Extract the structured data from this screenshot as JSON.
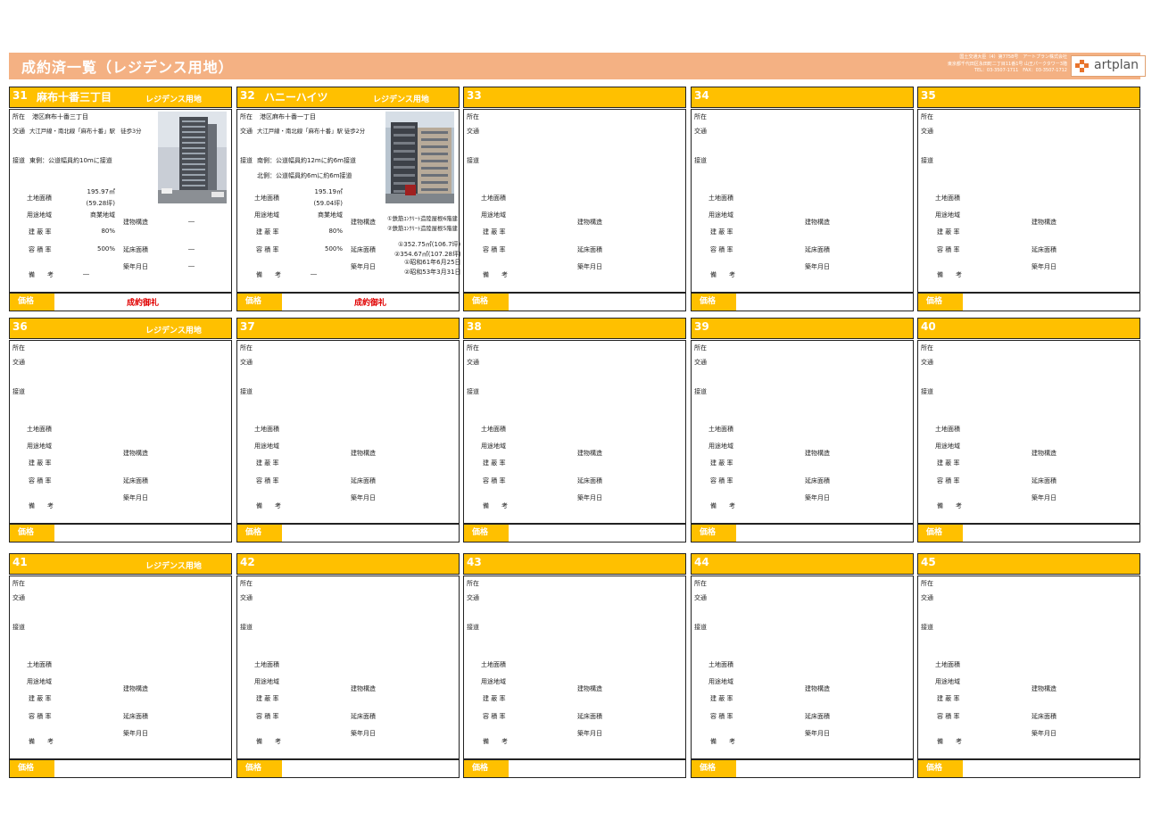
{
  "page": {
    "title": "成約済一覧（レジデンス用地）",
    "company": {
      "line1": "国土交通大臣（4）第7758号　アートプラン株式会社",
      "line2": "東京都千代田区永田町二丁目11番1号 山王パークタワー3階",
      "line3": "TEL：03-3507-1711　FAX：03-3507-1712"
    },
    "logo_text": "artplan",
    "colors": {
      "banner": "#f4b183",
      "header": "#ffc000",
      "sold": "#e00000"
    }
  },
  "labels": {
    "location": "所在",
    "access": "交通",
    "road": "接道",
    "land_area": "土地面積",
    "zoning": "用途地域",
    "coverage": "建 蔽 率",
    "far": "容 積 率",
    "remarks": "備　　考",
    "structure": "建物構造",
    "floor_area": "延床面積",
    "built": "築年月日",
    "price": "価格"
  },
  "cards": [
    {
      "num": "31",
      "name": "麻布十番三丁目",
      "tag": "レジデンス用地",
      "location": "港区麻布十番三丁目",
      "access": "大江戸線・南北線「麻布十番」駅　徒歩3分",
      "road1": "東側：公道幅員約10mに接道",
      "road2": "",
      "land1": "195.97㎡",
      "land2": "(59.28坪)",
      "zoning": "商業地域",
      "coverage": "80%",
      "far": "500%",
      "remarks": "―",
      "structure1": "―",
      "structure2": "",
      "floor1": "―",
      "floor2": "",
      "built1": "―",
      "built2": "",
      "price": "成約御礼"
    },
    {
      "num": "32",
      "name": "ハニーハイツ",
      "tag": "レジデンス用地",
      "location": "港区麻布十番一丁目",
      "access": "大江戸線・南北線「麻布十番」駅 徒歩2分",
      "road1": "南側：公道幅員約12mに約6m接道",
      "road2": "北側：公道幅員約6mに約6m接道",
      "land1": "195.19㎡",
      "land2": "(59.04坪)",
      "zoning": "商業地域",
      "coverage": "80%",
      "far": "500%",
      "remarks": "―",
      "structure1": "①鉄筋ｺﾝｸﾘｰﾄ造陸屋根6階建",
      "structure2": "②鉄筋ｺﾝｸﾘｰﾄ造陸屋根5階建",
      "floor1": "①352.75㎡(106.7坪)",
      "floor2": "②354.67㎡(107.28坪)",
      "built1": "①昭和61年6月25日",
      "built2": "②昭和53年3月31日",
      "price": "成約御礼"
    },
    {
      "num": "33",
      "name": "",
      "tag": ""
    },
    {
      "num": "34",
      "name": "",
      "tag": ""
    },
    {
      "num": "35",
      "name": "",
      "tag": ""
    },
    {
      "num": "36",
      "name": "",
      "tag": "レジデンス用地"
    },
    {
      "num": "37",
      "name": "",
      "tag": ""
    },
    {
      "num": "38",
      "name": "",
      "tag": ""
    },
    {
      "num": "39",
      "name": "",
      "tag": ""
    },
    {
      "num": "40",
      "name": "",
      "tag": ""
    },
    {
      "num": "41",
      "name": "",
      "tag": "レジデンス用地"
    },
    {
      "num": "42",
      "name": "",
      "tag": ""
    },
    {
      "num": "43",
      "name": "",
      "tag": ""
    },
    {
      "num": "44",
      "name": "",
      "tag": ""
    },
    {
      "num": "45",
      "name": "",
      "tag": ""
    }
  ]
}
